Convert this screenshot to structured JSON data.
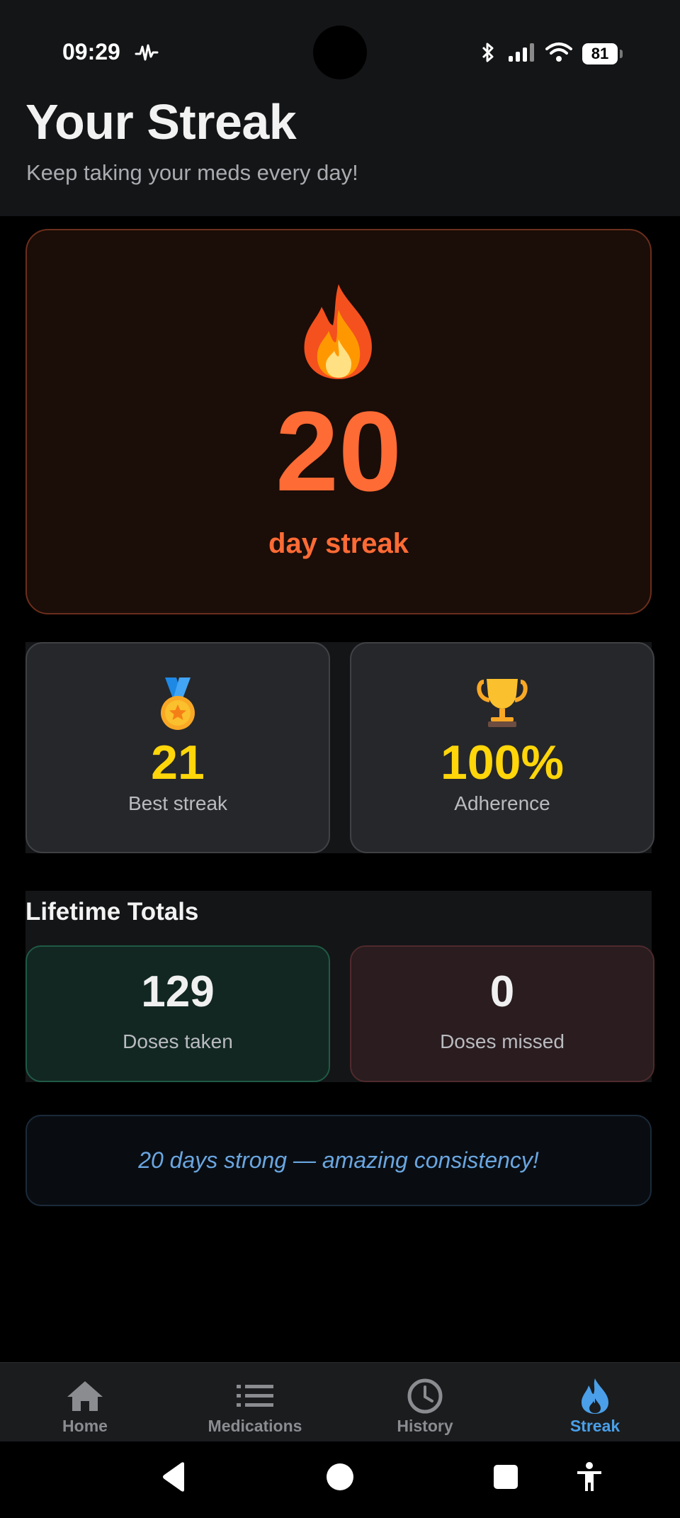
{
  "status_bar": {
    "time": "09:29",
    "battery": "81",
    "icons": [
      "activity-icon",
      "bluetooth-icon",
      "signal-icon",
      "wifi-icon",
      "battery-icon"
    ]
  },
  "header": {
    "title": "Your Streak",
    "subtitle": "Keep taking your meds every day!"
  },
  "streak": {
    "icon": "fire-icon",
    "value": "20",
    "label": "day streak"
  },
  "stats": [
    {
      "icon": "medal-icon",
      "value": "21",
      "label": "Best streak"
    },
    {
      "icon": "trophy-icon",
      "value": "100%",
      "label": "Adherence"
    }
  ],
  "lifetime": {
    "title": "Lifetime Totals",
    "taken": {
      "value": "129",
      "label": "Doses taken"
    },
    "missed": {
      "value": "0",
      "label": "Doses missed"
    }
  },
  "motivation": {
    "text": "20 days strong — amazing consistency!"
  },
  "tabs": [
    {
      "label": "Home",
      "icon": "home-icon",
      "active": false
    },
    {
      "label": "Medications",
      "icon": "list-icon",
      "active": false
    },
    {
      "label": "History",
      "icon": "clock-icon",
      "active": false
    },
    {
      "label": "Streak",
      "icon": "flame-icon",
      "active": true
    }
  ],
  "system_nav": [
    "back-icon",
    "home-circle-icon",
    "recents-icon",
    "accessibility-icon"
  ],
  "colors": {
    "accent_orange": "#ff6b35",
    "accent_yellow": "#ffd60a",
    "active_tab_blue": "#4a9fe8"
  }
}
